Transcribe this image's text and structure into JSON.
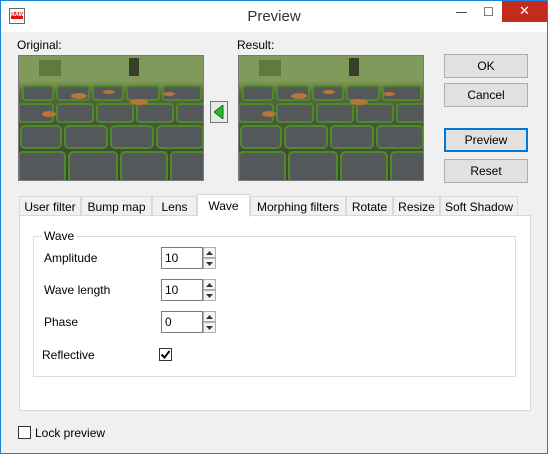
{
  "window": {
    "title": "Preview",
    "app_icon_text": "RAW",
    "controls": {
      "minimize": "—",
      "maximize": "☐",
      "close": "✕"
    }
  },
  "images": {
    "original_label": "Original:",
    "result_label": "Result:"
  },
  "buttons": {
    "ok": "OK",
    "cancel": "Cancel",
    "preview": "Preview",
    "reset": "Reset"
  },
  "tabs": [
    {
      "label": "User filter"
    },
    {
      "label": "Bump map"
    },
    {
      "label": "Lens"
    },
    {
      "label": "Wave",
      "active": true
    },
    {
      "label": "Morphing filters"
    },
    {
      "label": "Rotate"
    },
    {
      "label": "Resize"
    },
    {
      "label": "Soft Shadow"
    }
  ],
  "wave_group": {
    "title": "Wave",
    "amplitude_label": "Amplitude",
    "amplitude_value": "10",
    "wave_length_label": "Wave length",
    "wave_length_value": "10",
    "phase_label": "Phase",
    "phase_value": "0",
    "reflective_label": "Reflective",
    "reflective_checked": true
  },
  "lock_preview": {
    "label": "Lock preview",
    "checked": false
  },
  "colors": {
    "accent": "#0078d7",
    "close_red": "#c42b1c",
    "arrow_green": "#2db52d"
  }
}
